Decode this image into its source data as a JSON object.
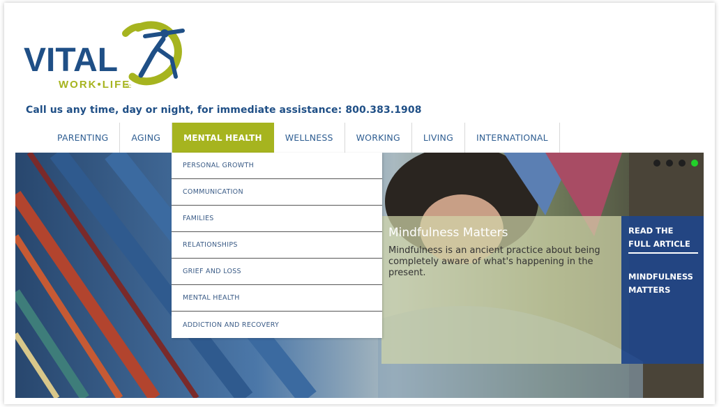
{
  "logo": {
    "word_main": "VITAL",
    "word_sub": "WORK•LIFE",
    "word_mark": "PC",
    "colors": {
      "blue": "#1f4f86",
      "green": "#a6b41f"
    }
  },
  "header": {
    "callus": "Call us any time, day or night, for immediate assistance: 800.383.1908"
  },
  "nav": {
    "items": [
      {
        "label": "PARENTING",
        "active": false
      },
      {
        "label": "AGING",
        "active": false
      },
      {
        "label": "MENTAL HEALTH",
        "active": true
      },
      {
        "label": "WELLNESS",
        "active": false
      },
      {
        "label": "WORKING",
        "active": false
      },
      {
        "label": "LIVING",
        "active": false
      },
      {
        "label": "INTERNATIONAL",
        "active": false
      }
    ]
  },
  "dropdown": {
    "items": [
      "PERSONAL GROWTH",
      "COMMUNICATION",
      "FAMILIES",
      "RELATIONSHIPS",
      "GRIEF AND LOSS",
      "MENTAL HEALTH",
      "ADDICTION AND RECOVERY"
    ]
  },
  "hero": {
    "title": "Mindfulness Matters",
    "text": "Mindfulness is an ancient practice about being completely aware of what's happening in the present.",
    "side": {
      "link1": "READ THE FULL ARTICLE",
      "link2": "MINDFULNESS MATTERS"
    },
    "slides": {
      "count": 4,
      "active_index": 3
    }
  }
}
